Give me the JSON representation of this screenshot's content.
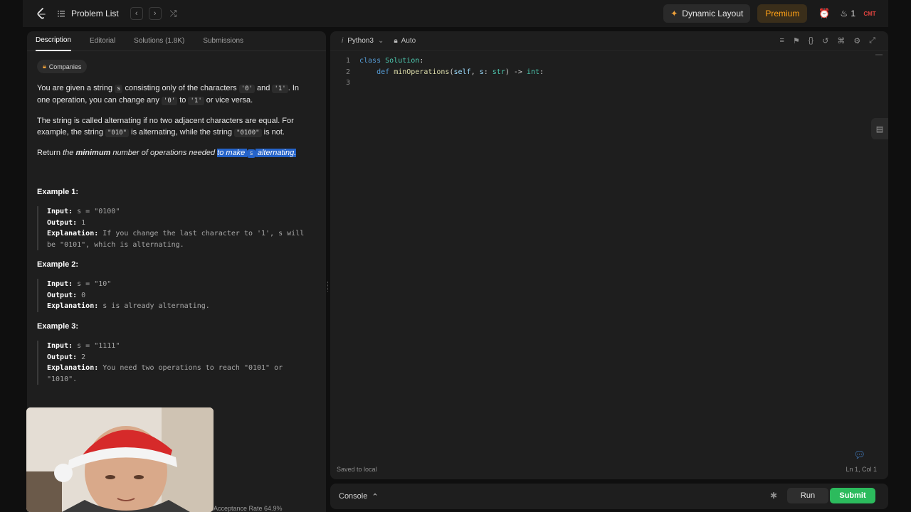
{
  "topbar": {
    "problem_list_label": "Problem List",
    "prev_icon": "chevron-left-icon",
    "next_icon": "chevron-right-icon",
    "shuffle_icon": "shuffle-icon",
    "dynamic_layout_label": "Dynamic Layout",
    "premium_label": "Premium",
    "streak_count": "1",
    "avatar_text": "CMT",
    "accent_color": "#ffa116"
  },
  "left": {
    "tabs": [
      {
        "label": "Description",
        "active": true
      },
      {
        "label": "Editorial"
      },
      {
        "label": "Solutions (1.8K)"
      },
      {
        "label": "Submissions"
      }
    ],
    "companies_label": "Companies",
    "p1": {
      "a": "You are given a string ",
      "s": "s",
      "b": " consisting only of the characters ",
      "zero": "'0'",
      "and": " and ",
      "one": "'1'",
      "c": ". In one operation, you can change any ",
      "zero2": "'0'",
      "to": " to ",
      "one2": "'1'",
      "d": " or vice versa."
    },
    "p2": {
      "a": "The string is called alternating if no two adjacent characters are equal. For example, the string ",
      "ex1": "\"010\"",
      "b": " is alternating, while the string ",
      "ex2": "\"0100\"",
      "c": " is not."
    },
    "p3": {
      "a": "Return ",
      "the": "the ",
      "min": "minimum",
      "b": " number of operations needed ",
      "sel1": "to make ",
      "s": "s",
      "sel2": " alternating."
    },
    "examples": [
      {
        "title": "Example 1:",
        "input_k": "Input:",
        "input_v": " s = \"0100\"",
        "output_k": "Output:",
        "output_v": " 1",
        "expl_k": "Explanation:",
        "expl_v": " If you change the last character to '1', s will be \"0101\", which is alternating."
      },
      {
        "title": "Example 2:",
        "input_k": "Input:",
        "input_v": " s = \"10\"",
        "output_k": "Output:",
        "output_v": " 0",
        "expl_k": "Explanation:",
        "expl_v": " s is already alternating."
      },
      {
        "title": "Example 3:",
        "input_k": "Input:",
        "input_v": " s = \"1111\"",
        "output_k": "Output:",
        "output_v": " 2",
        "expl_k": "Explanation:",
        "expl_v": " You need two operations to reach \"0101\" or \"1010\"."
      }
    ],
    "acceptance_partial": "Acceptance Rate  64.9%"
  },
  "editor": {
    "language": "Python3",
    "mode": "Auto",
    "line_numbers": [
      "1",
      "2",
      "3"
    ],
    "saved_label": "Saved to local",
    "cursor_pos": "Ln 1, Col 1"
  },
  "bottom": {
    "console_label": "Console",
    "run_label": "Run",
    "submit_label": "Submit",
    "submit_color": "#2cbb5d"
  }
}
